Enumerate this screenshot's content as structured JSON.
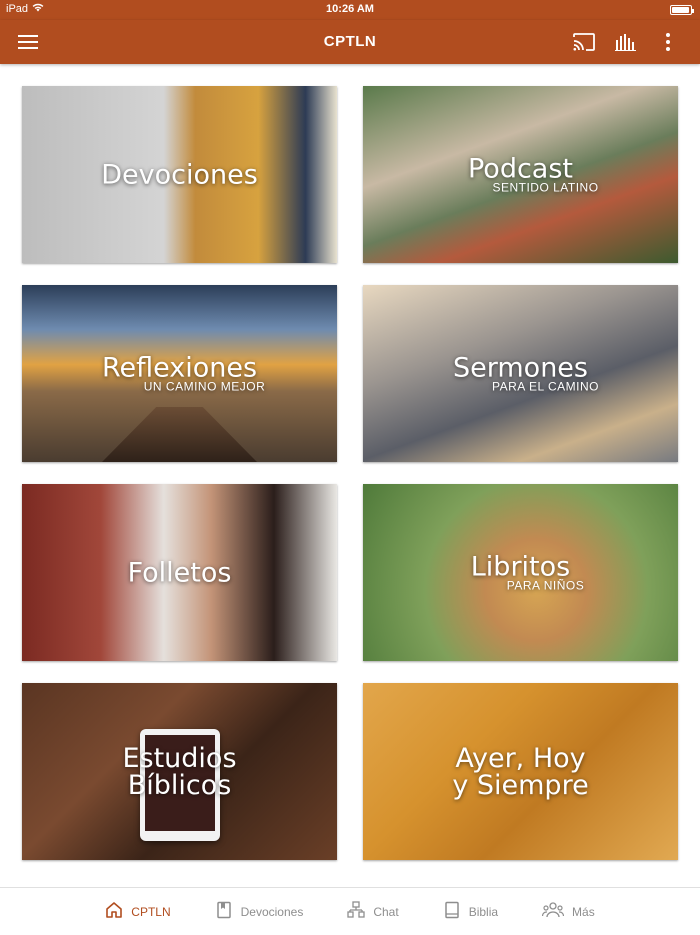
{
  "status_bar": {
    "device": "iPad",
    "time": "10:26 AM",
    "battery_level": 0.95
  },
  "app_bar": {
    "title": "CPTLN"
  },
  "tiles": [
    {
      "title": "Devociones",
      "subtitle": ""
    },
    {
      "title": "Podcast",
      "subtitle": "SENTIDO LATINO"
    },
    {
      "title": "Reflexiones",
      "subtitle": "UN CAMINO MEJOR"
    },
    {
      "title": "Sermones",
      "subtitle": "PARA EL CAMINO"
    },
    {
      "title": "Folletos",
      "subtitle": ""
    },
    {
      "title": "Libritos",
      "subtitle": "PARA NIÑOS"
    },
    {
      "title": "Estudios Bíblicos",
      "subtitle": ""
    },
    {
      "title": "Ayer, Hoy y Siempre",
      "subtitle": ""
    }
  ],
  "tab_bar": {
    "items": [
      {
        "label": "CPTLN",
        "icon": "home-icon",
        "active": true
      },
      {
        "label": "Devociones",
        "icon": "bookmark-icon",
        "active": false
      },
      {
        "label": "Chat",
        "icon": "chat-icon",
        "active": false
      },
      {
        "label": "Biblia",
        "icon": "book-icon",
        "active": false
      },
      {
        "label": "Más",
        "icon": "people-icon",
        "active": false
      }
    ]
  },
  "colors": {
    "brand": "#b14d1f",
    "tab_inactive": "#8e8e8e"
  }
}
